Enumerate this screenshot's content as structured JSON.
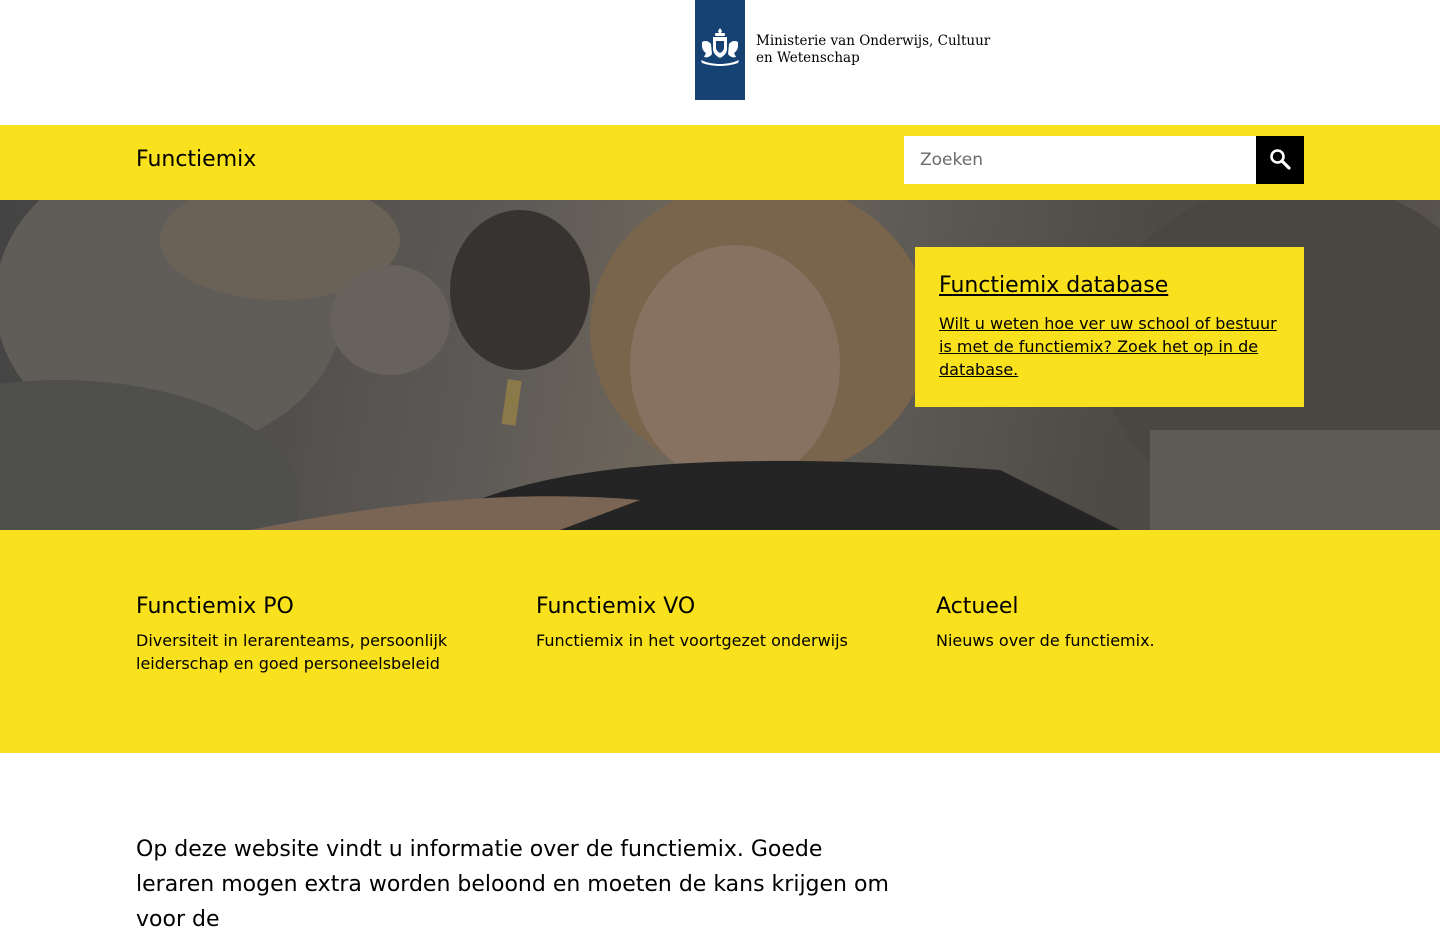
{
  "header": {
    "ministry_name": "Ministerie van Onderwijs, Cultuur en Wetenschap",
    "logo_icon": "coat-of-arms-icon",
    "brand_color": "#154273"
  },
  "site_bar": {
    "title": "Functiemix",
    "search": {
      "placeholder": "Zoeken",
      "value": "",
      "button_icon": "search-icon"
    },
    "accent_color": "#f9e11e"
  },
  "hero": {
    "card": {
      "title": "Functiemix database",
      "text": "Wilt u weten hoe ver uw school of bestuur is met de functiemix? Zoek het op in de database."
    }
  },
  "tiles": [
    {
      "title": "Functiemix PO",
      "description": "Diversiteit in lerarenteams, persoonlijk leiderschap en goed personeelsbeleid"
    },
    {
      "title": "Functiemix VO",
      "description": "Functiemix in het voortgezet onderwijs"
    },
    {
      "title": "Actueel",
      "description": "Nieuws over de functiemix."
    }
  ],
  "intro": {
    "text": "Op deze website vindt u informatie over de functiemix. Goede leraren mogen extra worden beloond en moeten de kans krijgen om voor de"
  }
}
